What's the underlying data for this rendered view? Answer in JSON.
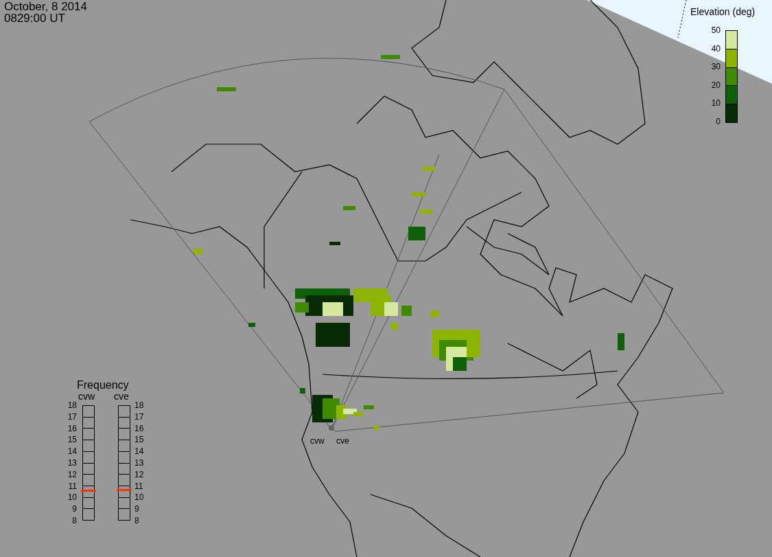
{
  "timestamp": {
    "date": "October, 8 2014",
    "time": "0829:00 UT"
  },
  "map": {
    "radars": [
      {
        "name": "cvw"
      },
      {
        "name": "cve"
      }
    ]
  },
  "colorbar": {
    "title": "Elevation (deg)",
    "ticks": [
      "50",
      "40",
      "30",
      "20",
      "10",
      "0"
    ]
  },
  "frequency": {
    "title": "Frequency",
    "meters": [
      {
        "label": "cvw",
        "level": 0.26,
        "ticks": [
          "18",
          "17",
          "16",
          "15",
          "14",
          "13",
          "12",
          "11",
          "10",
          "9",
          "8"
        ]
      },
      {
        "label": "cve",
        "level": 0.27,
        "ticks": [
          "18",
          "17",
          "16",
          "15",
          "14",
          "13",
          "12",
          "11",
          "10",
          "9",
          "8"
        ]
      }
    ]
  }
}
